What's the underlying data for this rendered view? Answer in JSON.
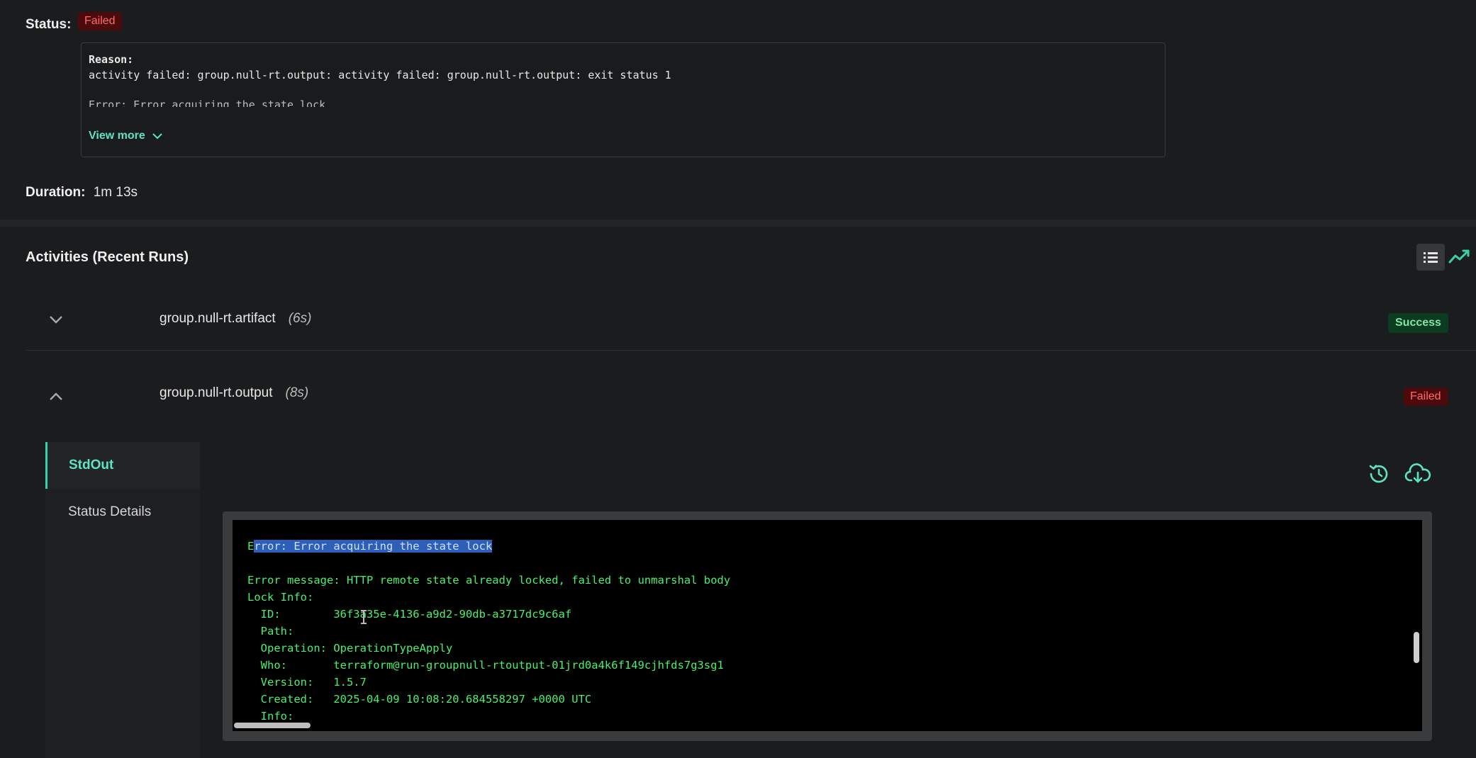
{
  "status": {
    "label": "Status:",
    "badge": "Failed",
    "reason_title": "Reason:",
    "reason_line": "activity failed: group.null-rt.output: activity failed: group.null-rt.output: exit status 1",
    "reason_cut": "Error: Error acquiring the state lock",
    "view_more": "View more"
  },
  "duration": {
    "label": "Duration:",
    "value": "1m 13s"
  },
  "activities": {
    "title": "Activities (Recent Runs)",
    "items": [
      {
        "name": "group.null-rt.artifact",
        "duration": "(6s)",
        "status": "Success"
      },
      {
        "name": "group.null-rt.output",
        "duration": "(8s)",
        "status": "Failed"
      }
    ]
  },
  "tabs": {
    "stdout": "StdOut",
    "status_details": "Status Details"
  },
  "terminal": {
    "lines": [
      {
        "text_first": "E",
        "text_highlight": "rror: Error acquiring the state lock"
      },
      {
        "text": ""
      },
      {
        "text": "Error message: HTTP remote state already locked, failed to unmarshal body"
      },
      {
        "text": "Lock Info:"
      },
      {
        "text": "  ID:        36f3a35e-4136-a9d2-90db-a3717dc9c6af"
      },
      {
        "text": "  Path:"
      },
      {
        "text": "  Operation: OperationTypeApply"
      },
      {
        "text": "  Who:       terraform@run-groupnull-rtoutput-01jrd0a4k6f149cjhfds7g3sg1"
      },
      {
        "text": "  Version:   1.5.7"
      },
      {
        "text": "  Created:   2025-04-09 10:08:20.684558297 +0000 UTC"
      },
      {
        "text": "  Info:"
      }
    ]
  },
  "colors": {
    "accent": "#5ee3c4",
    "failed_bg": "#4d0a0c",
    "failed_fg": "#ff6b6b",
    "success_bg": "#0d3b22",
    "success_fg": "#7fe7a3",
    "terminal_text": "#49f06a"
  },
  "icons": {
    "view_more": "chevron-down-icon",
    "list_view": "list-icon",
    "chart_view": "trend-line-icon",
    "collapsed": "chevron-down-icon",
    "expanded": "chevron-up-icon",
    "history": "history-clock-icon",
    "download": "cloud-download-icon"
  }
}
